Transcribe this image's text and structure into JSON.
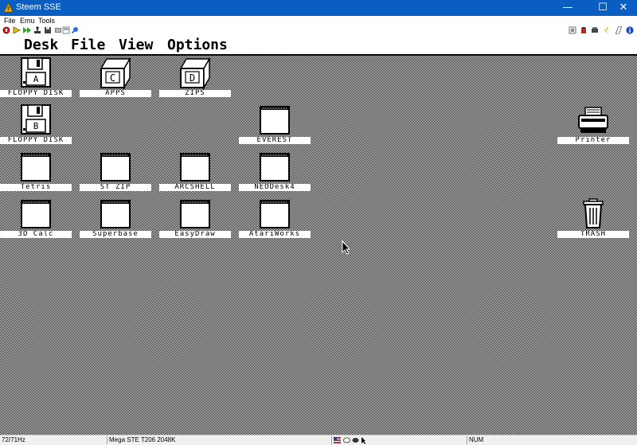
{
  "window": {
    "title": "Steem SSE",
    "min_glyph": "—",
    "max_glyph": "☐",
    "close_glyph": "✕"
  },
  "host_menu": [
    "File",
    "Emu",
    "Tools"
  ],
  "toolbar": {
    "left": [
      "reset-icon",
      "play-icon",
      "fast-forward-icon",
      "joystick-icon",
      "disk-manager-icon",
      "memory-snapshot-icon",
      "screenshot-icon",
      "patch-icon"
    ],
    "right": [
      "shortcuts-icon",
      "paste-icon",
      "sound-icon",
      "patch-wand-icon",
      "options-icon",
      "info-icon"
    ]
  },
  "gem_menu": [
    "Desk",
    "File",
    "View",
    "Options"
  ],
  "desktop": {
    "icons": [
      {
        "id": "floppy-a",
        "type": "floppy",
        "letter": "A",
        "label": "FLOPPY DISK"
      },
      {
        "id": "floppy-b",
        "type": "floppy",
        "letter": "B",
        "label": "FLOPPY DISK"
      },
      {
        "id": "drive-c",
        "type": "drive",
        "letter": "C",
        "label": "APPS"
      },
      {
        "id": "drive-d",
        "type": "drive",
        "letter": "D",
        "label": "ZIPS"
      },
      {
        "id": "everest",
        "type": "folder",
        "label": "EVEREST"
      },
      {
        "id": "printer",
        "type": "printer",
        "label": "Printer"
      },
      {
        "id": "tetris",
        "type": "folder",
        "label": "Tetris"
      },
      {
        "id": "st-zip",
        "type": "folder",
        "label": "ST ZIP"
      },
      {
        "id": "arcshell",
        "type": "folder",
        "label": "ARCSHELL"
      },
      {
        "id": "neodesk4",
        "type": "folder",
        "label": "NEODesk4"
      },
      {
        "id": "3d-calc",
        "type": "folder",
        "label": "3D Calc"
      },
      {
        "id": "superbase",
        "type": "folder",
        "label": "Superbase"
      },
      {
        "id": "easydraw",
        "type": "folder",
        "label": "EasyDraw"
      },
      {
        "id": "atariworks",
        "type": "folder",
        "label": "AtariWorks"
      },
      {
        "id": "trash",
        "type": "trash",
        "label": "TRASH"
      }
    ]
  },
  "status": {
    "fps": "72/71Hz",
    "machine": "Mega STE T206 2048K",
    "numlock": "NUM"
  },
  "colors": {
    "titlebar": "#0a5ec2",
    "desktop_fg": "#000000",
    "desktop_bg": "#ffffff"
  }
}
